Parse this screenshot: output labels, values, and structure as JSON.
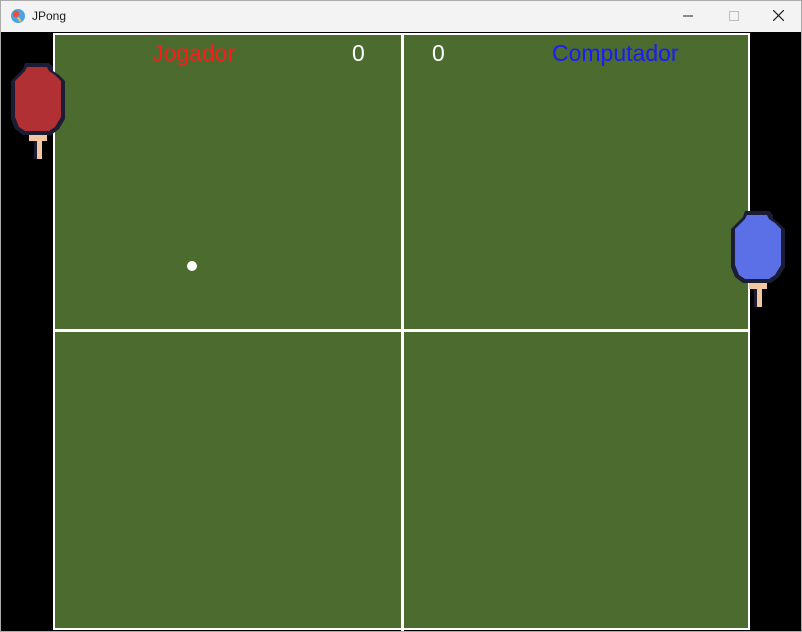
{
  "window": {
    "title": "JPong",
    "controls": [
      "minimize",
      "maximize",
      "close"
    ]
  },
  "scoreboard": {
    "player_label": "Jogador",
    "player_score": "0",
    "cpu_label": "Computador",
    "cpu_score": "0"
  },
  "colors": {
    "table": "#4b6b2f",
    "lines": "#ffffff",
    "player_paddle": "#b03033",
    "cpu_paddle": "#5b6fe6",
    "player_label": "#ff1a1a",
    "cpu_label": "#1a1aff"
  },
  "icons": {
    "app": "jpong-app-icon",
    "minimize": "minimize-icon",
    "maximize": "maximize-icon",
    "close": "close-icon"
  }
}
